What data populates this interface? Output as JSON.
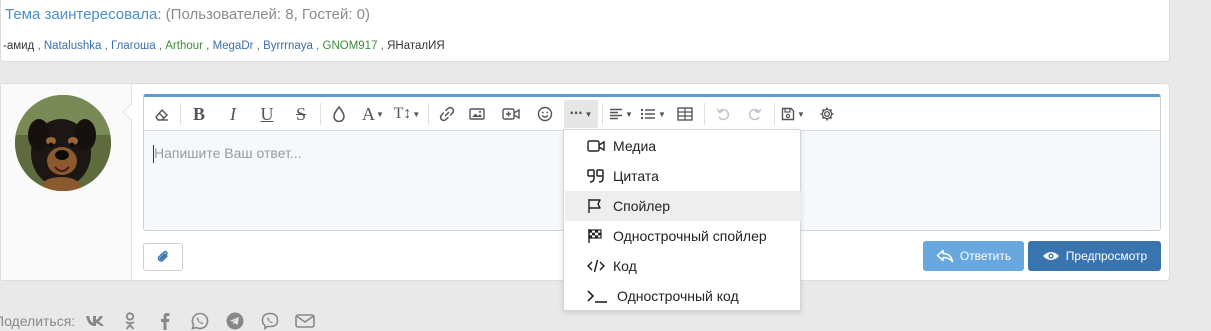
{
  "users_block": {
    "title_link": "Тема заинтересовала:",
    "title_counts": " (Пользователей: 8, Гостей: 0)",
    "users": [
      {
        "name": "-амид",
        "style": "plain"
      },
      {
        "name": "Natalushka",
        "style": "blue"
      },
      {
        "name": "Глагоша",
        "style": "blue"
      },
      {
        "name": "Arthour",
        "style": "green"
      },
      {
        "name": "MegaDr",
        "style": "blue"
      },
      {
        "name": "Byrrrnaya",
        "style": "blue"
      },
      {
        "name": "GNOM917",
        "style": "green"
      },
      {
        "name": "ЯНаталИЯ",
        "style": "plain"
      }
    ],
    "separator": " , "
  },
  "editor": {
    "placeholder": "Напишите Ваш ответ...",
    "toolbar_icons": [
      "eraser-icon",
      "bold-icon",
      "italic-icon",
      "underline-icon",
      "strikethrough-icon",
      "color-drop-icon",
      "font-family-icon",
      "font-size-icon",
      "link-icon",
      "image-icon",
      "media-icon",
      "smiley-icon",
      "more-icon",
      "align-icon",
      "list-icon",
      "table-icon",
      "undo-icon",
      "redo-icon",
      "drafts-icon",
      "settings-icon"
    ],
    "toolbar_labels": {
      "bold": "B",
      "italic": "I",
      "underline": "U",
      "strike": "S",
      "font": "A",
      "size": "T↕"
    }
  },
  "dropdown": {
    "items": [
      {
        "label": "Медиа",
        "icon": "video-icon"
      },
      {
        "label": "Цитата",
        "icon": "quote-icon"
      },
      {
        "label": "Спойлер",
        "icon": "flag-icon"
      },
      {
        "label": "Однострочный спойлер",
        "icon": "checkered-flag-icon"
      },
      {
        "label": "Код",
        "icon": "code-icon"
      },
      {
        "label": "Однострочный код",
        "icon": "terminal-icon"
      }
    ],
    "hover_index": 2
  },
  "buttons": {
    "reply": "Ответить",
    "preview": "Предпросмотр"
  },
  "share": {
    "label": "Поделиться:",
    "icons": [
      "vk-icon",
      "odnoklassniki-icon",
      "facebook-icon",
      "whatsapp-icon",
      "telegram-icon",
      "viber-icon",
      "email-icon"
    ]
  },
  "colors": {
    "link_blue": "#4a8fc9",
    "reply_button": "#68a8de",
    "preview_button": "#3a74ae",
    "editor_accent": "#5b9bd5"
  }
}
